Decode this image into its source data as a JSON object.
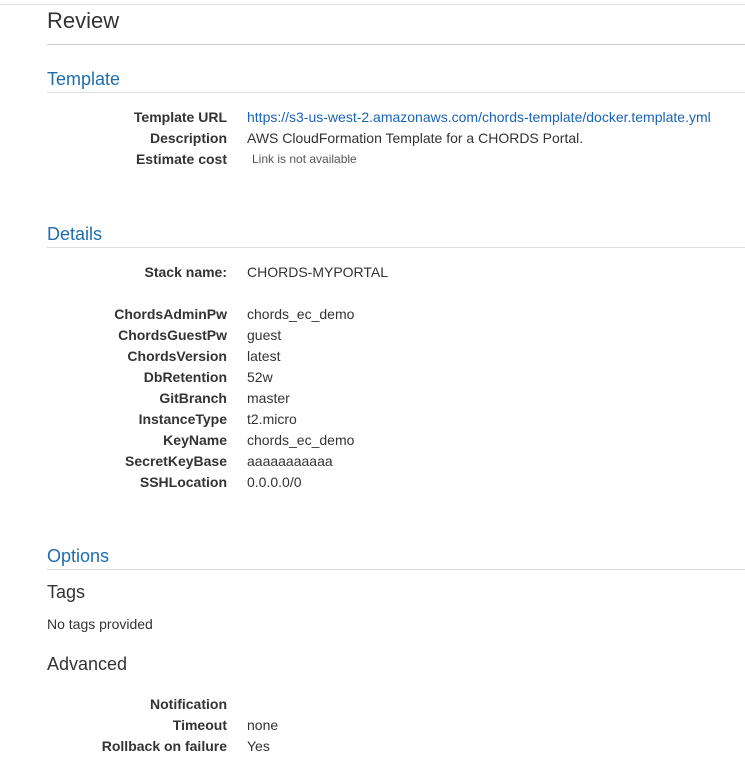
{
  "page": {
    "title": "Review"
  },
  "template_section": {
    "title": "Template",
    "rows": [
      {
        "label": "Template URL",
        "value": "https://s3-us-west-2.amazonaws.com/chords-template/docker.template.yml"
      },
      {
        "label": "Description",
        "value": "AWS CloudFormation Template for a CHORDS Portal."
      },
      {
        "label": "Estimate cost",
        "value": "Link is not available"
      }
    ]
  },
  "details_section": {
    "title": "Details",
    "stack": {
      "label": "Stack name:",
      "value": "CHORDS-MYPORTAL"
    },
    "params": [
      {
        "label": "ChordsAdminPw",
        "value": "chords_ec_demo"
      },
      {
        "label": "ChordsGuestPw",
        "value": "guest"
      },
      {
        "label": "ChordsVersion",
        "value": "latest"
      },
      {
        "label": "DbRetention",
        "value": "52w"
      },
      {
        "label": "GitBranch",
        "value": "master"
      },
      {
        "label": "InstanceType",
        "value": "t2.micro"
      },
      {
        "label": "KeyName",
        "value": "chords_ec_demo"
      },
      {
        "label": "SecretKeyBase",
        "value": "aaaaaaaaaaa"
      },
      {
        "label": "SSHLocation",
        "value": "0.0.0.0/0"
      }
    ]
  },
  "options_section": {
    "title": "Options",
    "tags": {
      "title": "Tags",
      "text": "No tags provided"
    },
    "advanced": {
      "title": "Advanced",
      "rows": [
        {
          "label": "Notification",
          "value": ""
        },
        {
          "label": "Timeout",
          "value": "none"
        },
        {
          "label": "Rollback on failure",
          "value": "Yes"
        }
      ]
    }
  }
}
